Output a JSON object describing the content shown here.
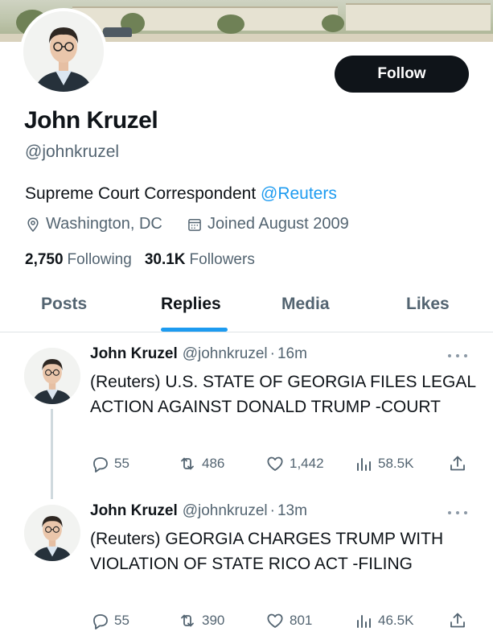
{
  "profile": {
    "name": "John Kruzel",
    "handle": "@johnkruzel",
    "bio_text": "Supreme Court Correspondent",
    "bio_mention": "@Reuters",
    "location": "Washington, DC",
    "joined": "Joined August 2009",
    "following_count": "2,750",
    "following_label": "Following",
    "followers_count": "30.1K",
    "followers_label": "Followers",
    "follow_button": "Follow"
  },
  "tabs": [
    {
      "label": "Posts",
      "active": false
    },
    {
      "label": "Replies",
      "active": true
    },
    {
      "label": "Media",
      "active": false
    },
    {
      "label": "Likes",
      "active": false
    }
  ],
  "posts": [
    {
      "name": "John Kruzel",
      "handle": "@johnkruzel",
      "dot": "·",
      "time": "16m",
      "text": "(Reuters) U.S. STATE OF GEORGIA FILES LEGAL ACTION AGAINST DONALD TRUMP -COURT",
      "replies": "55",
      "reposts": "486",
      "likes": "1,442",
      "views": "58.5K"
    },
    {
      "name": "John Kruzel",
      "handle": "@johnkruzel",
      "dot": "·",
      "time": "13m",
      "text": "(Reuters) GEORGIA CHARGES TRUMP WITH VIOLATION OF STATE RICO ACT -FILING",
      "replies": "55",
      "reposts": "390",
      "likes": "801",
      "views": "46.5K"
    }
  ],
  "colors": {
    "accent": "#1d9bf0",
    "text_primary": "#0f1419",
    "text_secondary": "#536471",
    "button_bg": "#0f1419"
  },
  "icons": [
    "location-pin-icon",
    "calendar-icon",
    "reply-icon",
    "repost-icon",
    "like-icon",
    "views-icon",
    "share-icon",
    "more-icon"
  ]
}
